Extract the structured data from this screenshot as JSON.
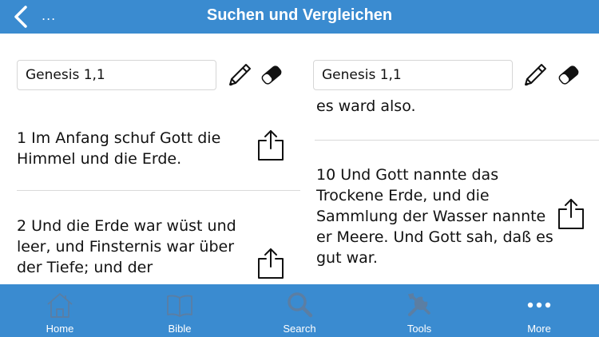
{
  "header": {
    "back_icon": "chevron-left-icon",
    "overflow_text": "...",
    "title": "Suchen und Vergleichen"
  },
  "left_pane": {
    "reference": "Genesis 1,1",
    "verses": [
      "1 Im Anfang schuf Gott die Himmel und die Erde.",
      "2 Und die Erde war wüst und leer, und Finsternis war über der Tiefe; und der"
    ]
  },
  "right_pane": {
    "reference": "Genesis 1,1",
    "verses": [
      "es ward also.",
      "10 Und Gott nannte das Trockene Erde, und die Sammlung der Wasser nannte er Meere. Und Gott sah, daß es gut war."
    ]
  },
  "tabs": [
    {
      "label": "Home",
      "icon": "home-icon"
    },
    {
      "label": "Bible",
      "icon": "book-icon"
    },
    {
      "label": "Search",
      "icon": "search-icon"
    },
    {
      "label": "Tools",
      "icon": "tools-icon"
    },
    {
      "label": "More",
      "icon": "more-icon"
    }
  ],
  "colors": {
    "accent": "#3a8bd0",
    "tab_icon": "#5b7ea3",
    "tab_active": "#ffffff"
  }
}
